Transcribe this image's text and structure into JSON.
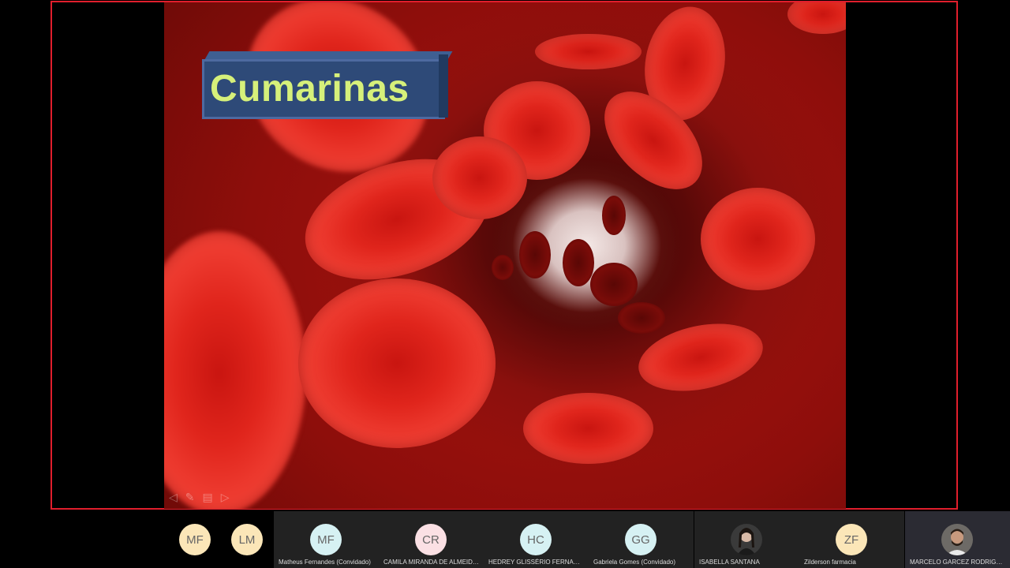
{
  "slide": {
    "title": "Cumarinas",
    "controls": [
      "◁",
      "✎",
      "▤",
      "▷"
    ]
  },
  "participants": [
    {
      "initials": "MF",
      "name": "",
      "avatar_color": "#fbe6b8"
    },
    {
      "initials": "LM",
      "name": "",
      "avatar_color": "#fbe6b8"
    },
    {
      "initials": "MF",
      "name": "Matheus Fernandes (Convidado)",
      "avatar_color": "#d6f1f3"
    },
    {
      "initials": "CR",
      "name": "CAMILA MIRANDA DE ALMEIDA R...",
      "avatar_color": "#fbe0e4"
    },
    {
      "initials": "HC",
      "name": "HEDREY GLISSÉRIO FERNANDES C...",
      "avatar_color": "#d6f1f3"
    },
    {
      "initials": "GG",
      "name": "Gabriela Gomes (Convidado)",
      "avatar_color": "#d6f1f3"
    },
    {
      "initials": "",
      "name": "ISABELLA SANTANA",
      "avatar_color": "#4a4a4a"
    },
    {
      "initials": "ZF",
      "name": "Zilderson farmacia",
      "avatar_color": "#fbe6b8"
    },
    {
      "initials": "",
      "name": "MARCELO GARCEZ RODRIGUES",
      "avatar_color": "#4a4a4a"
    }
  ],
  "colors": {
    "frame_border": "#e01e2c",
    "title_text": "#d6f07a",
    "title_box": "#2e4a78"
  }
}
